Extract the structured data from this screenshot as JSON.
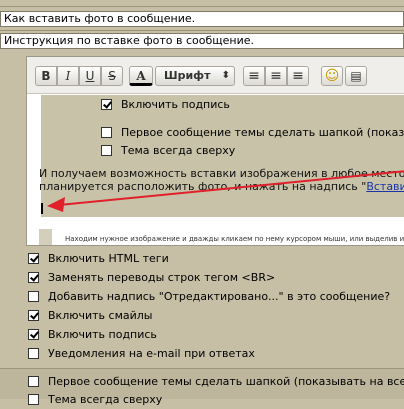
{
  "fields": {
    "topic_title": "Как вставить фото в сообщение.",
    "topic_description": "Инструкция по вставке фото в сообщение."
  },
  "toolbar": {
    "bold": "B",
    "italic": "I",
    "underline": "U",
    "strike": "S",
    "font_color": "A",
    "font_label": "Шрифт",
    "font_arrows": "⬍",
    "align_left": "≡",
    "align_center": "≡",
    "align_right": "≡",
    "smiley": "☺",
    "last_icon": "▤"
  },
  "inner_options": [
    {
      "label": "Включить подпись",
      "checked": true
    },
    {
      "label": "Первое сообщение темы сделать шапкой (показыв",
      "checked": false
    },
    {
      "label": "Тема всегда сверху",
      "checked": false
    }
  ],
  "editor": {
    "line1": "И получаем возможность вставки изображения в любое место со",
    "line2_pre": "планируется расположить фото, и нажать на надпись \"",
    "line2_link": "Вставить",
    "hint": "Находим нужное изображение и дважды кликаем по нему курсором мыши, или выделив и"
  },
  "lower_options": [
    {
      "label": "Включить HTML теги",
      "checked": true
    },
    {
      "label": "Заменять переводы строк тегом <BR>",
      "checked": true
    },
    {
      "label": "Добавить надпись \"Отредактировано...\" в это сообщение?",
      "checked": false
    },
    {
      "label": "Включить смайлы",
      "checked": true
    },
    {
      "label": "Включить подпись",
      "checked": true
    },
    {
      "label": "Уведомления на e-mail при ответах",
      "checked": false
    }
  ],
  "bottom_options": [
    {
      "label": "Первое сообщение темы сделать шапкой (показывать на всех",
      "checked": false
    },
    {
      "label": "Тема всегда сверху",
      "checked": false
    }
  ],
  "colors": {
    "background": "#c6bfa6",
    "arrow": "#e0202a",
    "link": "#1a34a8"
  }
}
